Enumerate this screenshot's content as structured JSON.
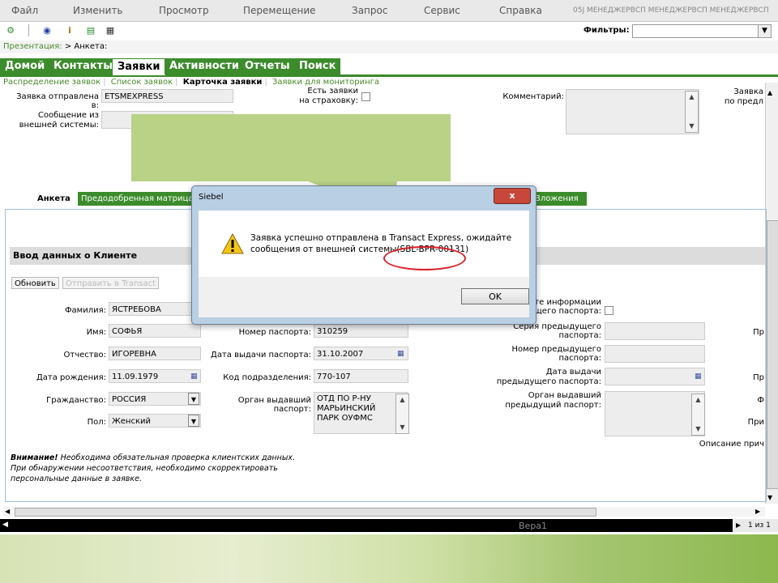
{
  "menubar": {
    "items": [
      "Файл",
      "Изменить",
      "Просмотр",
      "Перемещение",
      "Запрос",
      "Сервис",
      "Справка"
    ],
    "user": "05J МЕНЕДЖЕРВСП МЕНЕДЖЕРВСП МЕНЕДЖЕРВСП"
  },
  "toolbar": {
    "filters_label": "Фильтры:",
    "filters_value": ""
  },
  "breadcrumb": {
    "root": "Презентация:",
    "current": "> Анкета:"
  },
  "main_tabs": [
    "Домой",
    "Контакты",
    "Заявки",
    "Активности",
    "Отчеты",
    "Поиск"
  ],
  "main_tabs_active": "Заявки",
  "sub_links": [
    "Распределение заявок",
    "Список заявок",
    "Карточка заявки",
    "Заявки для мониторинга"
  ],
  "sub_links_active": "Карточка заявки",
  "request": {
    "sent_to_label": "Заявка отправлена в:",
    "sent_to_value": "ETSMEXPRESS",
    "external_msg_label_1": "Сообщение из",
    "external_msg_label_2": "внешней системы:",
    "insurance_label_1": "Есть заявки",
    "insurance_label_2": "на страховку:",
    "comment_label": "Комментарий:",
    "right_label_1": "Заявка",
    "right_label_2": "по предл"
  },
  "sub_tabs": [
    "Анкета",
    "Предодобренная матрица",
    "Вложения"
  ],
  "sub_tabs_active": "Анкета",
  "section": {
    "title": "Ввод данных о Клиенте",
    "refresh_button": "Обновить",
    "send_button": "Отправить в Transact"
  },
  "client": {
    "surname_label": "Фамилия:",
    "surname": "ЯСТРЕБОВА",
    "name_label": "Имя:",
    "name": "СОФЬЯ",
    "patronymic_label": "Отчество:",
    "patronymic": "ИГОРЕВНА",
    "birthdate_label": "Дата рождения:",
    "birthdate": "11.09.1979",
    "citizenship_label": "Гражданство:",
    "citizenship": "РОССИЯ",
    "gender_label": "Пол:",
    "gender": "Женский"
  },
  "passport": {
    "number_label": "Номер паспорта:",
    "number": "310259",
    "issue_date_label": "Дата выдачи паспорта:",
    "issue_date": "31.10.2007",
    "division_label": "Код подразделения:",
    "division": "770-107",
    "issuer_label": "Орган выдавший паспорт:",
    "issuer_lines": [
      "ОТД ПО Р-НУ",
      "МАРЬИНСКИЙ",
      "ПАРК ОУФМС"
    ]
  },
  "prev_passport": {
    "info_label_1": "рте информации",
    "info_label_2": "ущего паспорта:",
    "series_label_1": "Серия предыдущего",
    "series_label_2": "паспорта:",
    "number_label_1": "Номер предыдущего",
    "number_label_2": "паспорта:",
    "date_label_1": "Дата выдачи",
    "date_label_2": "предыдущего паспорта:",
    "issuer_label_1": "Орган выдавший",
    "issuer_label_2": "предыдущий паспорт:",
    "right_labels": [
      "Пр",
      "Пр",
      "Ф",
      "При"
    ],
    "desc_label": "Описание прич"
  },
  "warning": {
    "strong": "Внимание!",
    "line1": " Необходима обязательная проверка клиентских данных.",
    "line2": "При обнаружении несоответствия, необходимо скорректировать",
    "line3": "персональные данные в заявке."
  },
  "statusbar": {
    "text": "Вера1",
    "pager": "1 из 1"
  },
  "dialog": {
    "title": "Siebel",
    "close": "x",
    "message_line1": "Заявка успешно отправлена в Transact Express, ожидайте",
    "message_line2": "сообщения от внешней системы(SBL-BPR-00131)",
    "ok": "OK"
  },
  "colors": {
    "tab_green": "#3c8c2c",
    "callout": "#b9d286",
    "highlight": "#d8202a"
  }
}
